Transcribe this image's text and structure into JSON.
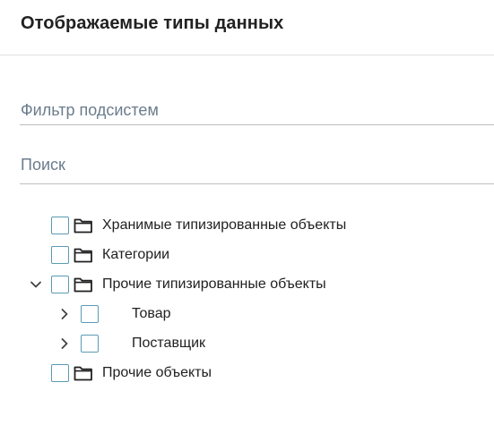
{
  "header": {
    "title": "Отображаемые типы данных"
  },
  "filter": {
    "placeholder": "Фильтр подсистем",
    "value": ""
  },
  "search": {
    "placeholder": "Поиск",
    "value": ""
  },
  "tree": {
    "items": [
      {
        "label": "Хранимые типизированные объекты",
        "expander": "none",
        "checked": false,
        "icon": "folder-icon"
      },
      {
        "label": "Категории",
        "expander": "none",
        "checked": false,
        "icon": "folder-icon"
      },
      {
        "label": "Прочие типизированные объекты",
        "expander": "expanded",
        "checked": false,
        "icon": "folder-icon"
      },
      {
        "label": "Товар",
        "expander": "collapsed",
        "checked": false,
        "icon": "none"
      },
      {
        "label": "Поставщик",
        "expander": "collapsed",
        "checked": false,
        "icon": "none"
      },
      {
        "label": "Прочие объекты",
        "expander": "none",
        "checked": false,
        "icon": "folder-icon"
      }
    ]
  },
  "colors": {
    "checkbox_border": "#5a9bb5",
    "placeholder": "#6b7c8c",
    "divider": "#e0e0e0"
  }
}
